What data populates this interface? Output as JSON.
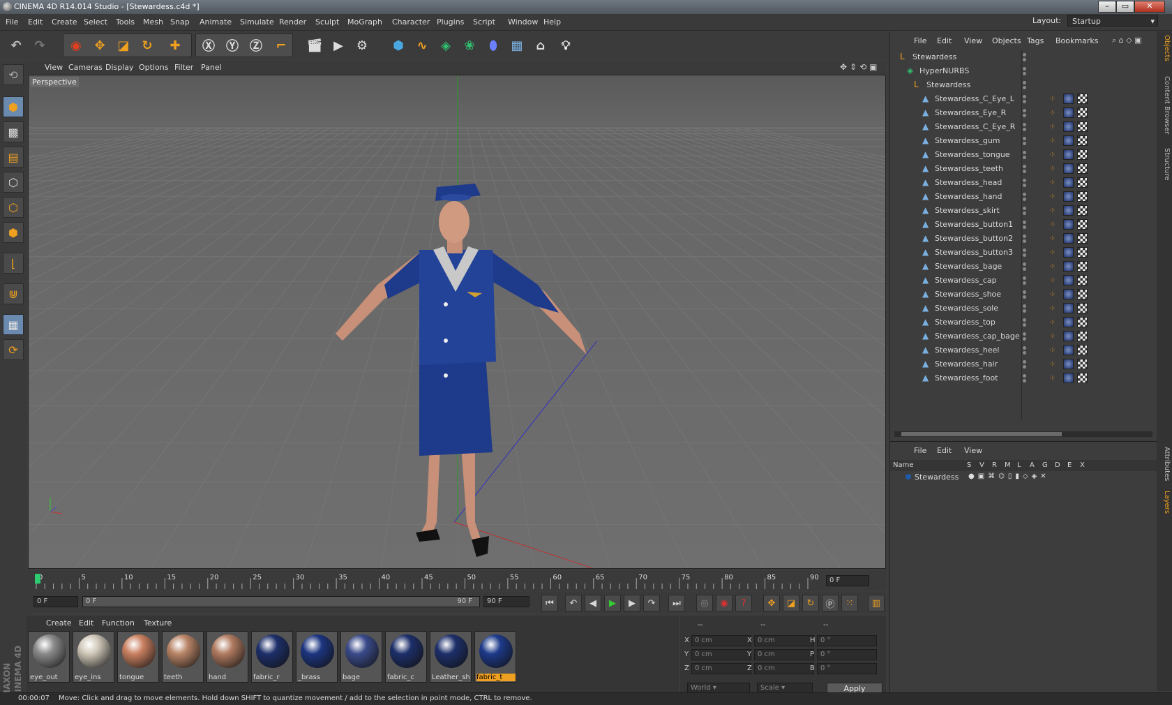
{
  "window": {
    "title": "CINEMA 4D R14.014 Studio - [Stewardess.c4d *]"
  },
  "menu": [
    "File",
    "Edit",
    "Create",
    "Select",
    "Tools",
    "Mesh",
    "Snap",
    "Animate",
    "Simulate",
    "Render",
    "Sculpt",
    "MoGraph",
    "Character",
    "Plugins",
    "Script",
    "Window",
    "Help"
  ],
  "layout": {
    "label": "Layout:",
    "value": "Startup"
  },
  "viewport": {
    "menu": [
      "View",
      "Cameras",
      "Display",
      "Options",
      "Filter",
      "Panel"
    ],
    "label": "Perspective"
  },
  "timeline": {
    "ticks": [
      "0",
      "5",
      "10",
      "15",
      "20",
      "25",
      "30",
      "35",
      "40",
      "45",
      "50",
      "55",
      "60",
      "65",
      "70",
      "75",
      "80",
      "85",
      "90"
    ],
    "current_frame_field": "0 F",
    "start_field": "0 F",
    "range_left": "0 F",
    "range_right": "90 F",
    "end_field": "90 F"
  },
  "material_manager": {
    "menu": [
      "Create",
      "Edit",
      "Function",
      "Texture"
    ],
    "materials": [
      {
        "name": "eye_out",
        "color": "#8a8a8a"
      },
      {
        "name": "eye_ins",
        "color": "#cfc7b8"
      },
      {
        "name": "tongue",
        "color": "#c98060"
      },
      {
        "name": "teeth",
        "color": "#b88466"
      },
      {
        "name": "hand",
        "color": "#b07a60"
      },
      {
        "name": "fabric_r",
        "color": "#1d2f6a"
      },
      {
        "name": "_brass",
        "color": "#1c3580"
      },
      {
        "name": "bage",
        "color": "#3a4a8a"
      },
      {
        "name": "fabric_c",
        "color": "#1d2f6a"
      },
      {
        "name": "Leather_sh",
        "color": "#1d2f6a"
      },
      {
        "name": "fabric_t",
        "color": "#1d3a8a",
        "selected": true
      }
    ]
  },
  "coordinates": {
    "header": [
      "--",
      "--",
      "--"
    ],
    "rows": [
      {
        "a": "X",
        "av": "0 cm",
        "b": "X",
        "bv": "0 cm",
        "c": "H",
        "cv": "0 °"
      },
      {
        "a": "Y",
        "av": "0 cm",
        "b": "Y",
        "bv": "0 cm",
        "c": "P",
        "cv": "0 °"
      },
      {
        "a": "Z",
        "av": "0 cm",
        "b": "Z",
        "bv": "0 cm",
        "c": "B",
        "cv": "0 °"
      }
    ],
    "mode": "World",
    "scale": "Scale",
    "apply": "Apply"
  },
  "status": {
    "time": "00:00:07",
    "message": "Move: Click and drag to move elements. Hold down SHIFT to quantize movement / add to the selection in point mode, CTRL to remove."
  },
  "object_manager": {
    "menu": [
      "File",
      "Edit",
      "View",
      "Objects",
      "Tags",
      "Bookmarks"
    ],
    "objects": [
      {
        "name": "Stewardess",
        "indent": 0
      },
      {
        "name": "HyperNURBS",
        "indent": 1
      },
      {
        "name": "Stewardess",
        "indent": 2
      },
      {
        "name": "Stewardess_C_Eye_L",
        "indent": 3
      },
      {
        "name": "Stewardess_Eye_R",
        "indent": 3
      },
      {
        "name": "Stewardess_C_Eye_R",
        "indent": 3
      },
      {
        "name": "Stewardess_gum",
        "indent": 3
      },
      {
        "name": "Stewardess_tongue",
        "indent": 3
      },
      {
        "name": "Stewardess_teeth",
        "indent": 3
      },
      {
        "name": "Stewardess_head",
        "indent": 3
      },
      {
        "name": "Stewardess_hand",
        "indent": 3
      },
      {
        "name": "Stewardess_skirt",
        "indent": 3
      },
      {
        "name": "Stewardess_button1",
        "indent": 3
      },
      {
        "name": "Stewardess_button2",
        "indent": 3
      },
      {
        "name": "Stewardess_button3",
        "indent": 3
      },
      {
        "name": "Stewardess_bage",
        "indent": 3
      },
      {
        "name": "Stewardess_cap",
        "indent": 3
      },
      {
        "name": "Stewardess_shoe",
        "indent": 3
      },
      {
        "name": "Stewardess_sole",
        "indent": 3
      },
      {
        "name": "Stewardess_top",
        "indent": 3
      },
      {
        "name": "Stewardess_cap_bage",
        "indent": 3
      },
      {
        "name": "Stewardess_heel",
        "indent": 3
      },
      {
        "name": "Stewardess_hair",
        "indent": 3
      },
      {
        "name": "Stewardess_foot",
        "indent": 3
      }
    ]
  },
  "layer_manager": {
    "menu": [
      "File",
      "Edit",
      "View"
    ],
    "columns": [
      "Name",
      "S",
      "V",
      "R",
      "M",
      "L",
      "A",
      "G",
      "D",
      "E",
      "X"
    ],
    "layers": [
      {
        "name": "Stewardess"
      }
    ]
  },
  "side_tabs": [
    "Objects",
    "Content Browser",
    "Structure",
    "Attributes",
    "Layers"
  ],
  "brand": [
    "MAXON",
    "CINEMA 4D"
  ]
}
